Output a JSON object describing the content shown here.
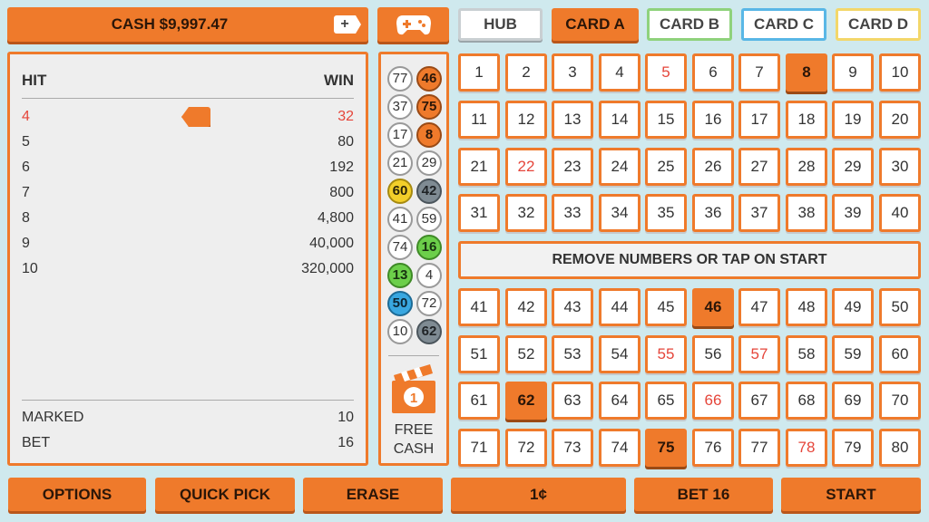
{
  "header": {
    "cash": "CASH $9,997.47",
    "add_cash": "+",
    "game_icon": "gamepad-icon",
    "tabs": [
      "HUB",
      "CARD A",
      "CARD B",
      "CARD C",
      "CARD D"
    ],
    "active_tab": "CARD A",
    "tab_border_colors": {
      "HUB": "#c9cfd2",
      "CARD B": "#8fd27c",
      "CARD C": "#59b7e6",
      "CARD D": "#f3d76a"
    }
  },
  "paytable": {
    "hit_label": "HIT",
    "win_label": "WIN",
    "rows": [
      {
        "hit": "4",
        "win": "32"
      },
      {
        "hit": "5",
        "win": "80"
      },
      {
        "hit": "6",
        "win": "192"
      },
      {
        "hit": "7",
        "win": "800"
      },
      {
        "hit": "8",
        "win": "4,800"
      },
      {
        "hit": "9",
        "win": "40,000"
      },
      {
        "hit": "10",
        "win": "320,000"
      }
    ],
    "highlighted_hit": "4",
    "marked_label": "MARKED",
    "marked_value": "10",
    "bet_label": "BET",
    "bet_value": "16"
  },
  "drawn_balls": [
    {
      "n": "77",
      "color": "white"
    },
    {
      "n": "46",
      "color": "orange"
    },
    {
      "n": "37",
      "color": "white"
    },
    {
      "n": "75",
      "color": "orange"
    },
    {
      "n": "17",
      "color": "white"
    },
    {
      "n": "8",
      "color": "orange"
    },
    {
      "n": "21",
      "color": "white"
    },
    {
      "n": "29",
      "color": "white"
    },
    {
      "n": "60",
      "color": "yellow"
    },
    {
      "n": "42",
      "color": "gray"
    },
    {
      "n": "41",
      "color": "white"
    },
    {
      "n": "59",
      "color": "white"
    },
    {
      "n": "74",
      "color": "white"
    },
    {
      "n": "16",
      "color": "green"
    },
    {
      "n": "13",
      "color": "green"
    },
    {
      "n": "4",
      "color": "white"
    },
    {
      "n": "50",
      "color": "blue"
    },
    {
      "n": "72",
      "color": "white"
    },
    {
      "n": "10",
      "color": "white"
    },
    {
      "n": "62",
      "color": "gray"
    }
  ],
  "free_cash": {
    "badge": "1",
    "label_line1": "FREE",
    "label_line2": "CASH"
  },
  "board": {
    "marked": [
      8,
      46,
      62,
      75
    ],
    "hit_red": [
      5,
      22,
      55,
      57,
      66,
      78
    ],
    "message": "REMOVE NUMBERS OR TAP ON START"
  },
  "bottom_bar": {
    "options": "OPTIONS",
    "quick_pick": "QUICK PICK",
    "erase": "ERASE",
    "denomination": "1¢",
    "bet": "BET 16",
    "start": "START"
  },
  "colors": {
    "accent": "#ef7a2b",
    "hit_text": "#e5453a",
    "background": "#cfe9ee"
  }
}
